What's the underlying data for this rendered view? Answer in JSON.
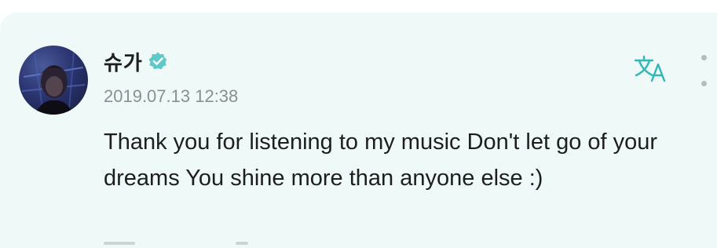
{
  "post": {
    "author": {
      "name": "슈가",
      "verified": true,
      "avatar_icon": "profile-photo"
    },
    "timestamp": "2019.07.13 12:38",
    "text": "Thank you for listening to my music Don't let go of your dreams You shine more than anyone else :)",
    "actions": {
      "translate_icon": "translate-icon",
      "more_icon": "more-vertical-icon"
    }
  },
  "colors": {
    "card_background": "#eef9f8",
    "verified_badge": "#5fc9c9",
    "translate_icon": "#2fb8b8",
    "text_primary": "#1e1e1e",
    "text_secondary": "#8a8f92"
  }
}
